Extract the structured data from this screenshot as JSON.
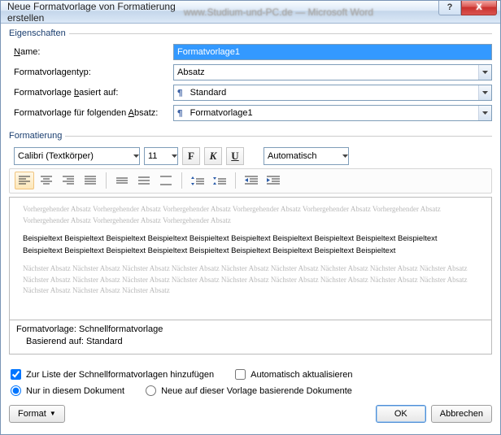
{
  "window": {
    "title": "Neue Formatvorlage von Formatierung erstellen",
    "blurred_subtitle": "www.Studium-und-PC.de — Microsoft Word",
    "help_glyph": "?",
    "close_glyph": "X"
  },
  "groups": {
    "properties_legend": "Eigenschaften",
    "formatting_legend": "Formatierung"
  },
  "fields": {
    "name_label": "Name:",
    "name_value": "Formatvorlage1",
    "type_label": "Formatvorlagentyp:",
    "type_value": "Absatz",
    "based_label_pre": "Formatvorlage ",
    "based_label_u": "b",
    "based_label_post": "asiert auf:",
    "based_value": "Standard",
    "following_label_pre": "Formatvorlage für folgenden ",
    "following_label_u": "A",
    "following_label_post": "bsatz:",
    "following_value": "Formatvorlage1"
  },
  "format_toolbar": {
    "font_name": "Calibri (Textkörper)",
    "font_size": "11",
    "bold_glyph": "F",
    "italic_glyph": "K",
    "underline_glyph": "U",
    "color_label": "Automatisch"
  },
  "preview": {
    "prev_text": "Vorhergehender Absatz Vorhergehender Absatz Vorhergehender Absatz Vorhergehender Absatz Vorhergehender Absatz Vorhergehender Absatz Vorhergehender Absatz Vorhergehender Absatz Vorhergehender Absatz",
    "sample_text": "Beispieltext Beispieltext Beispieltext Beispieltext Beispieltext Beispieltext Beispieltext Beispieltext Beispieltext Beispieltext Beispieltext Beispieltext Beispieltext Beispieltext Beispieltext Beispieltext Beispieltext Beispieltext Beispieltext",
    "next_text": "Nächster Absatz Nächster Absatz Nächster Absatz Nächster Absatz Nächster Absatz Nächster Absatz Nächster Absatz Nächster Absatz Nächster Absatz Nächster Absatz Nächster Absatz Nächster Absatz Nächster Absatz Nächster Absatz Nächster Absatz Nächster Absatz Nächster Absatz Nächster Absatz Nächster Absatz Nächster Absatz Nächster Absatz"
  },
  "style_summary": {
    "line1": "Formatvorlage: Schnellformatvorlage",
    "line2": "Basierend auf: Standard"
  },
  "options": {
    "quick_styles_label": "Zur Liste der Schnellformatvorlagen hinzufügen",
    "auto_update_label": "Automatisch aktualisieren",
    "only_doc_label": "Nur in diesem Dokument",
    "new_template_label": "Neue auf dieser Vorlage basierende Dokumente"
  },
  "buttons": {
    "format_label": "Format",
    "ok_label": "OK",
    "cancel_label": "Abbrechen"
  },
  "pilcrow": "¶"
}
